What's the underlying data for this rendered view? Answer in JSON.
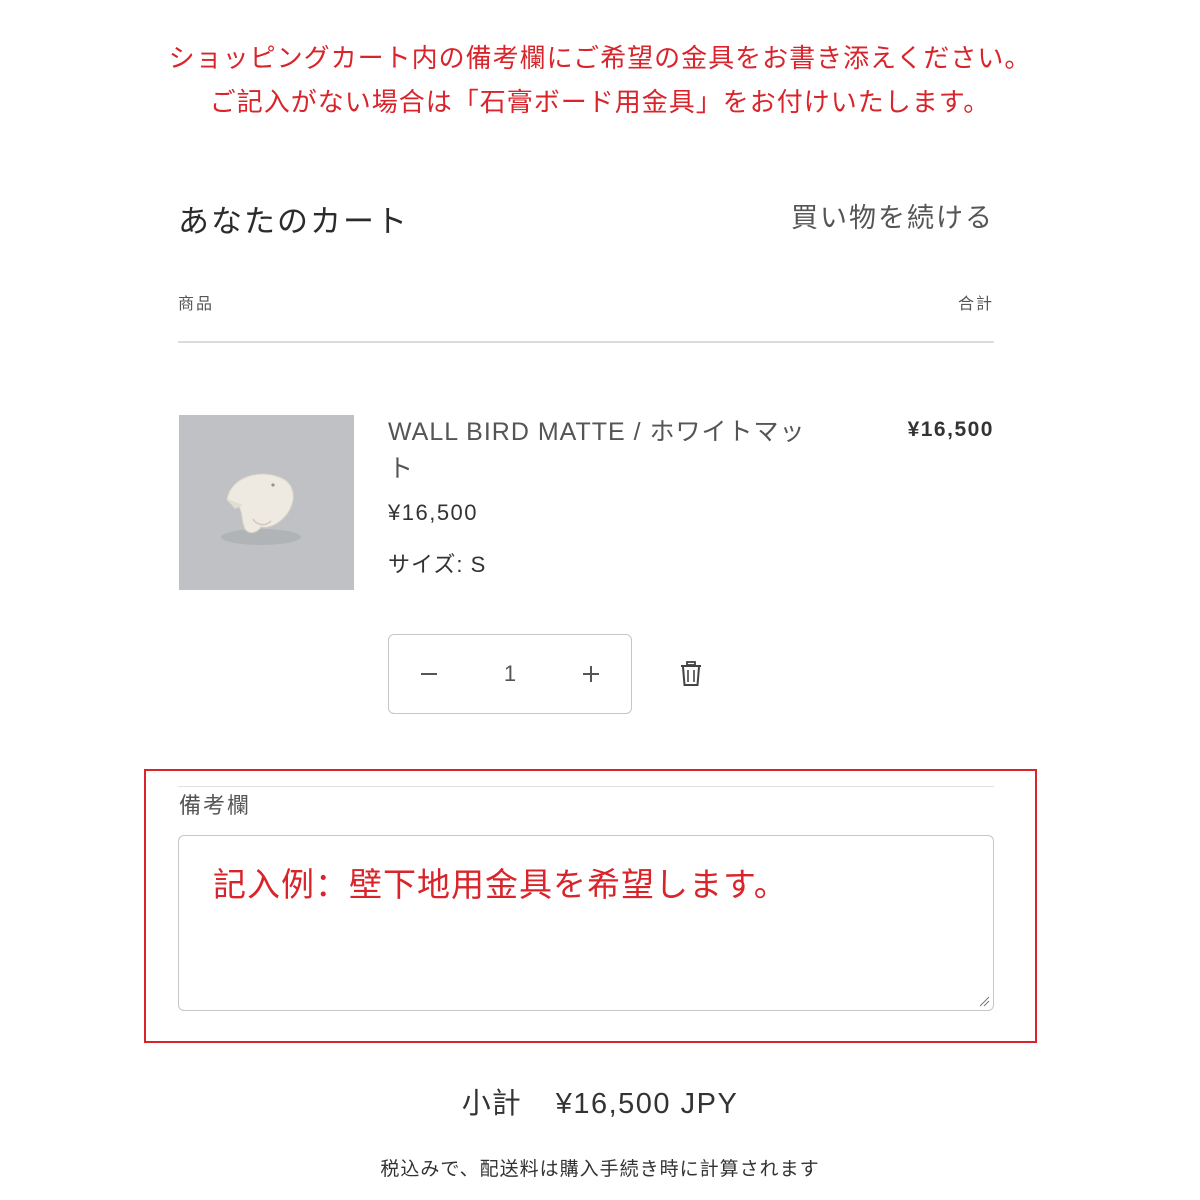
{
  "notice": {
    "line1": "ショッピングカート内の備考欄にご希望の金具をお書き添えください。",
    "line2": "ご記入がない場合は「石膏ボード用金具」をお付けいたします。"
  },
  "cart": {
    "title": "あなたのカート",
    "continue_label": "買い物を続ける",
    "columns": {
      "product": "商品",
      "total": "合計"
    },
    "item": {
      "name": "WALL BIRD MATTE / ホワイトマット",
      "price": "¥16,500",
      "line_total": "¥16,500",
      "variant": "サイズ: S",
      "quantity": "1",
      "image_icon": "white-bird-icon"
    },
    "icons": {
      "decrease": "minus-icon",
      "increase": "plus-icon",
      "remove": "trash-icon"
    },
    "note": {
      "label": "備考欄",
      "placeholder": "記入例：壁下地用金具を希望します。"
    },
    "subtotal_label": "小計",
    "subtotal_value": "¥16,500 JPY",
    "tax_note": "税込みで、配送料は購入手続き時に計算されます"
  },
  "colors": {
    "accent_red": "#d8242a",
    "text_dark": "#333333",
    "border_gray": "#c6c6c6",
    "image_bg": "#bfc1c4"
  }
}
